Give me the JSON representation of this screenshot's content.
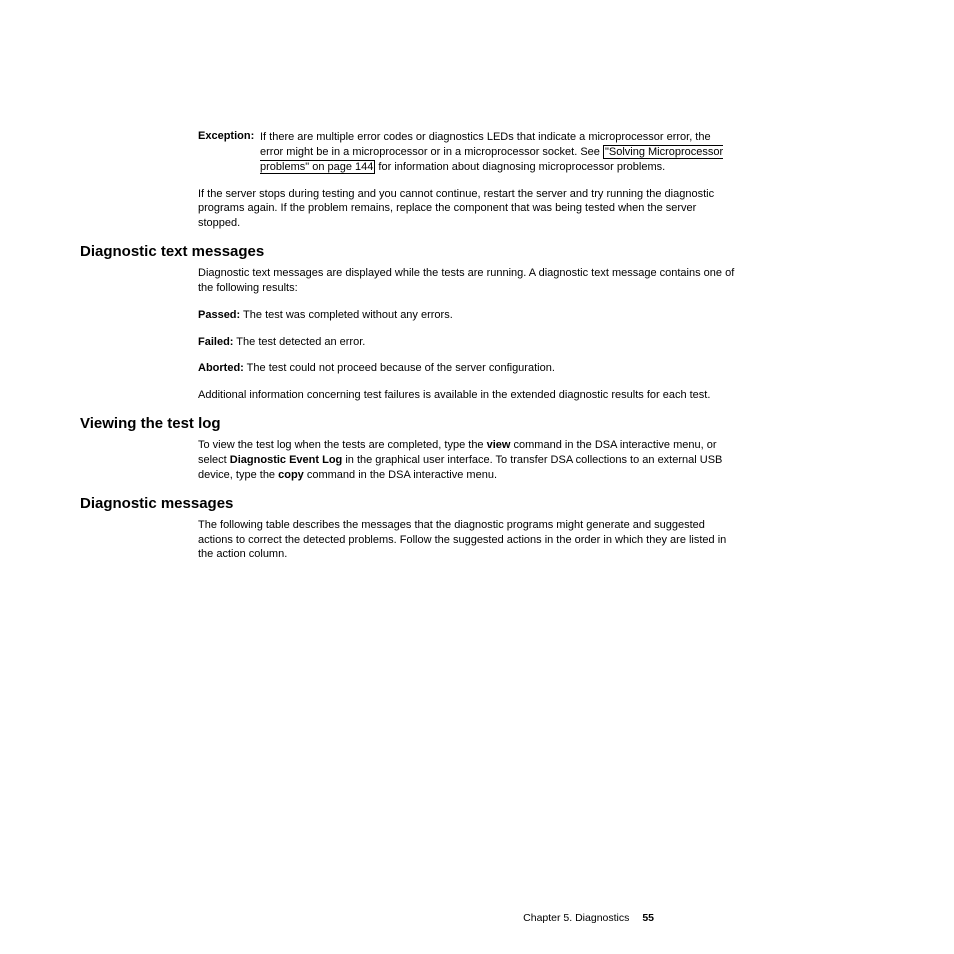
{
  "exception": {
    "label": "Exception:",
    "text_before_link": "If there are multiple error codes or diagnostics LEDs that indicate a microprocessor error, the error might be in a microprocessor or in a microprocessor socket. See ",
    "link_text": "\"Solving Microprocessor problems\" on page 144",
    "text_after_link": " for information about diagnosing microprocessor problems."
  },
  "para_restart": "If the server stops during testing and you cannot continue, restart the server and try running the diagnostic programs again. If the problem remains, replace the component that was being tested when the server stopped.",
  "sections": {
    "diag_text": {
      "heading": "Diagnostic text messages",
      "intro": "Diagnostic text messages are displayed while the tests are running. A diagnostic text message contains one of the following results:",
      "results": [
        {
          "label": "Passed:",
          "desc": " The test was completed without any errors."
        },
        {
          "label": "Failed:",
          "desc": " The test detected an error."
        },
        {
          "label": "Aborted:",
          "desc": " The test could not proceed because of the server configuration."
        }
      ],
      "additional": "Additional information concerning test failures is available in the extended diagnostic results for each test."
    },
    "view_log": {
      "heading": "Viewing the test log",
      "part1": "To view the test log when the tests are completed, type the ",
      "bold1": "view",
      "part2": " command in the DSA interactive menu, or select ",
      "bold2": "Diagnostic Event Log",
      "part3": " in the graphical user interface. To transfer DSA collections to an external USB device, type the ",
      "bold3": "copy",
      "part4": " command in the DSA interactive menu."
    },
    "diag_msgs": {
      "heading": "Diagnostic messages",
      "body": "The following table describes the messages that the diagnostic programs might generate and suggested actions to correct the detected problems. Follow the suggested actions in the order in which they are listed in the action column."
    }
  },
  "footer": {
    "chapter": "Chapter 5. Diagnostics",
    "page": "55"
  }
}
